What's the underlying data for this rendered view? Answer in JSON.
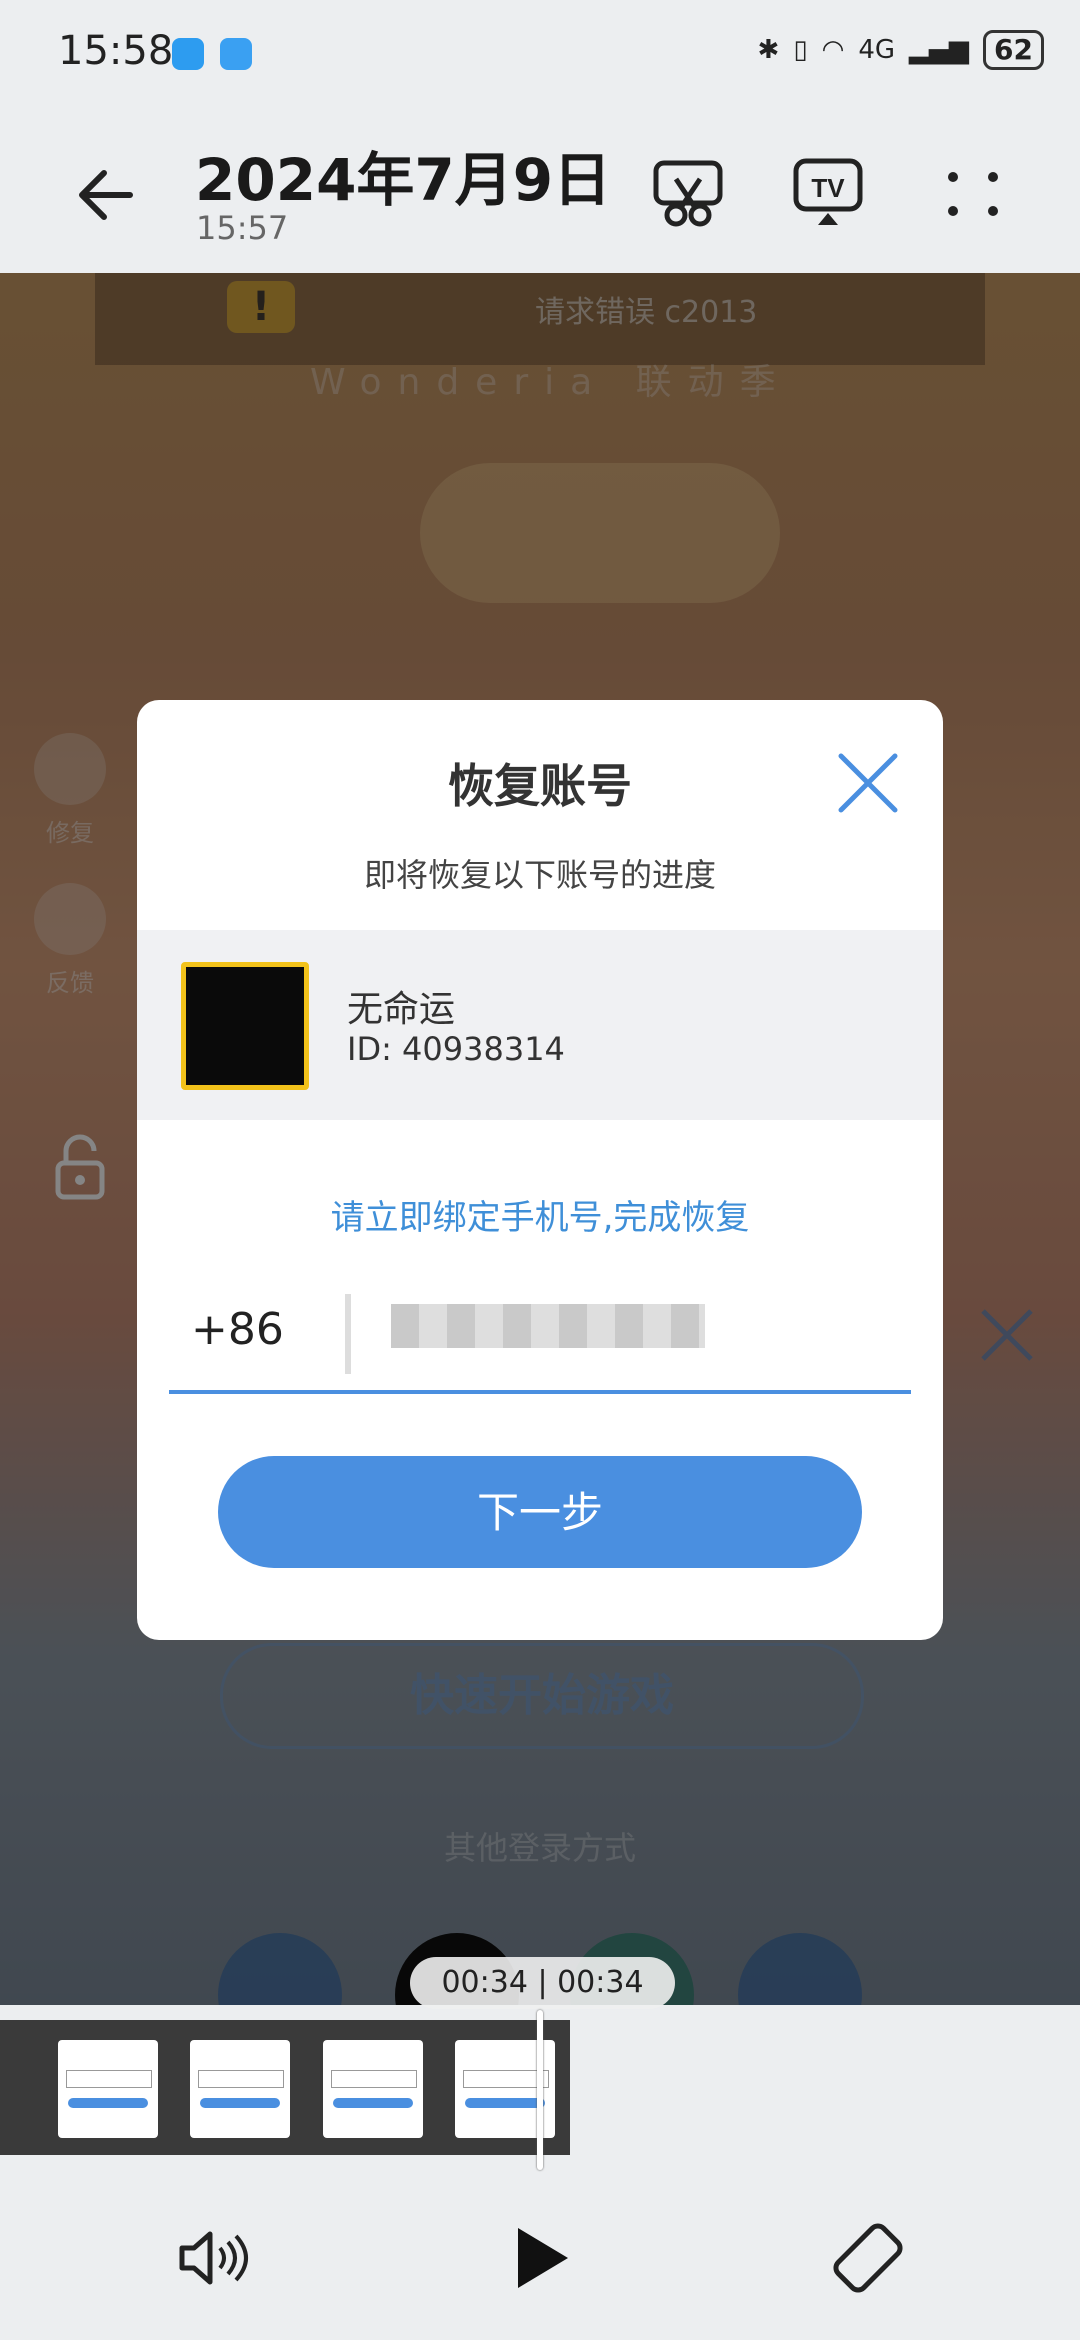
{
  "status_bar": {
    "time": "15:58",
    "battery": "62",
    "network": "4G"
  },
  "header": {
    "title": "2024年7月9日",
    "subtitle": "15:57"
  },
  "video": {
    "error_text": "请求错误 c2013",
    "banner_sub": "Wonderia 联动季",
    "side_repair": "修复",
    "side_feedback": "反馈",
    "quick_start": "快速开始游戏",
    "other_login": "其他登录方式"
  },
  "dialog": {
    "title": "恢复账号",
    "description": "即将恢复以下账号的进度",
    "account_name": "无命运",
    "account_id": "ID: 40938314",
    "bind_tip": "请立即绑定手机号,完成恢复",
    "country_code": "+86",
    "next_button": "下一步"
  },
  "player": {
    "time_display": "00:34 | 00:34"
  },
  "colors": {
    "accent": "#4a8fe0",
    "avatar_border": "#f2c21a"
  }
}
